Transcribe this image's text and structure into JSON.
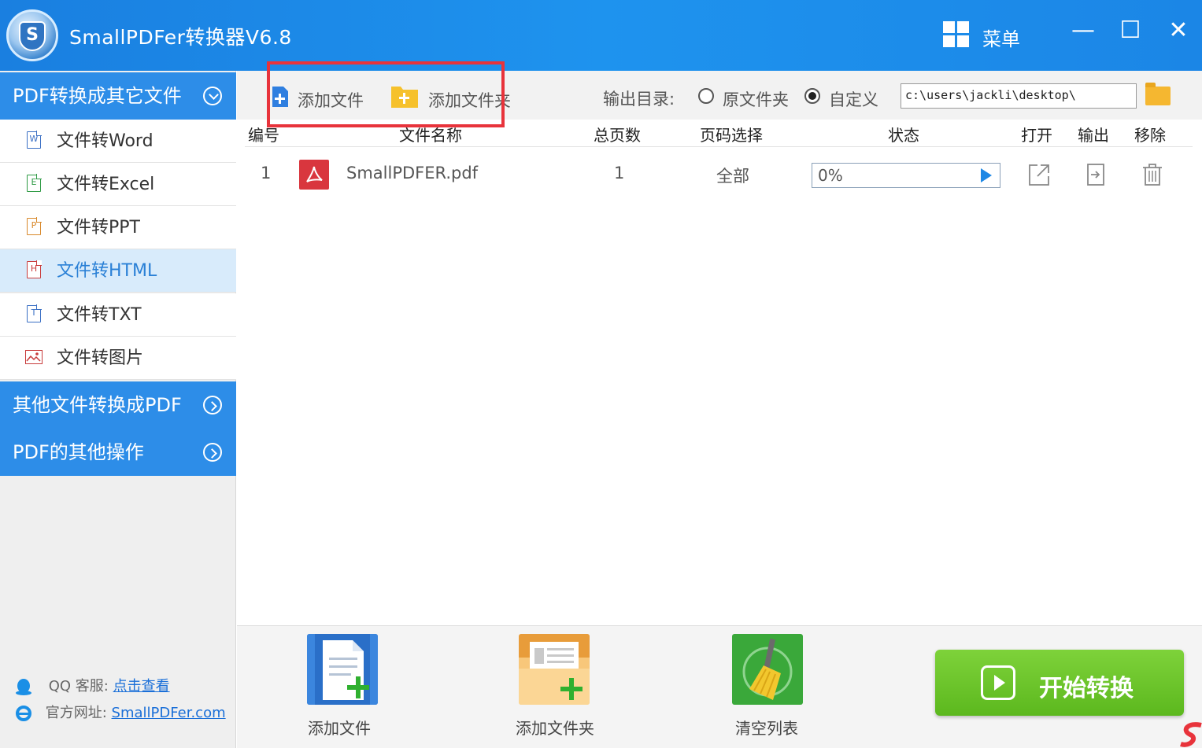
{
  "window": {
    "title": "SmallPDFer转换器V6.8",
    "logo_letter": "S",
    "menu_label": "菜单",
    "minimize": "—",
    "maximize": "☐",
    "close": "✕"
  },
  "sidebar": {
    "section1": "PDF转换成其它文件",
    "items": [
      {
        "label": "文件转Word",
        "icon": "W",
        "color": "#3a6fc4"
      },
      {
        "label": "文件转Excel",
        "icon": "E",
        "color": "#2e9a44"
      },
      {
        "label": "文件转PPT",
        "icon": "P",
        "color": "#d8882a"
      },
      {
        "label": "文件转HTML",
        "icon": "H",
        "color": "#c83b3b"
      },
      {
        "label": "文件转TXT",
        "icon": "T",
        "color": "#3a6fc4"
      },
      {
        "label": "文件转图片",
        "icon": "img",
        "color": "#c83b3b"
      }
    ],
    "active_item": "文件转HTML",
    "section2": "其他文件转换成PDF",
    "section3": "PDF的其他操作",
    "support": {
      "qq_label": "QQ 客服:",
      "qq_link": "点击查看",
      "site_label": "官方网址:",
      "site_link": "SmallPDFer.com"
    }
  },
  "toolbar": {
    "add_file": "添加文件",
    "add_folder": "添加文件夹",
    "output_label": "输出目录:",
    "option_original": "原文件夹",
    "option_custom": "自定义",
    "selected_option": "自定义",
    "output_path": "c:\\users\\jackli\\desktop\\"
  },
  "table": {
    "headers": {
      "index": "编号",
      "name": "文件名称",
      "pages": "总页数",
      "range": "页码选择",
      "status": "状态",
      "open": "打开",
      "output": "输出",
      "remove": "移除"
    },
    "rows": [
      {
        "index": "1",
        "name": "SmallPDFER.pdf",
        "pages": "1",
        "range": "全部",
        "progress": "0%"
      }
    ]
  },
  "bottom": {
    "add_file": "添加文件",
    "add_folder": "添加文件夹",
    "clear_list": "清空列表",
    "start": "开始转换"
  },
  "colors": {
    "title_bar": "#1e8be8",
    "sidebar_section": "#2d8de8",
    "active_item_bg": "#d8ebfb",
    "start_button": "#6cc42b",
    "highlight_box": "#e8333b"
  }
}
